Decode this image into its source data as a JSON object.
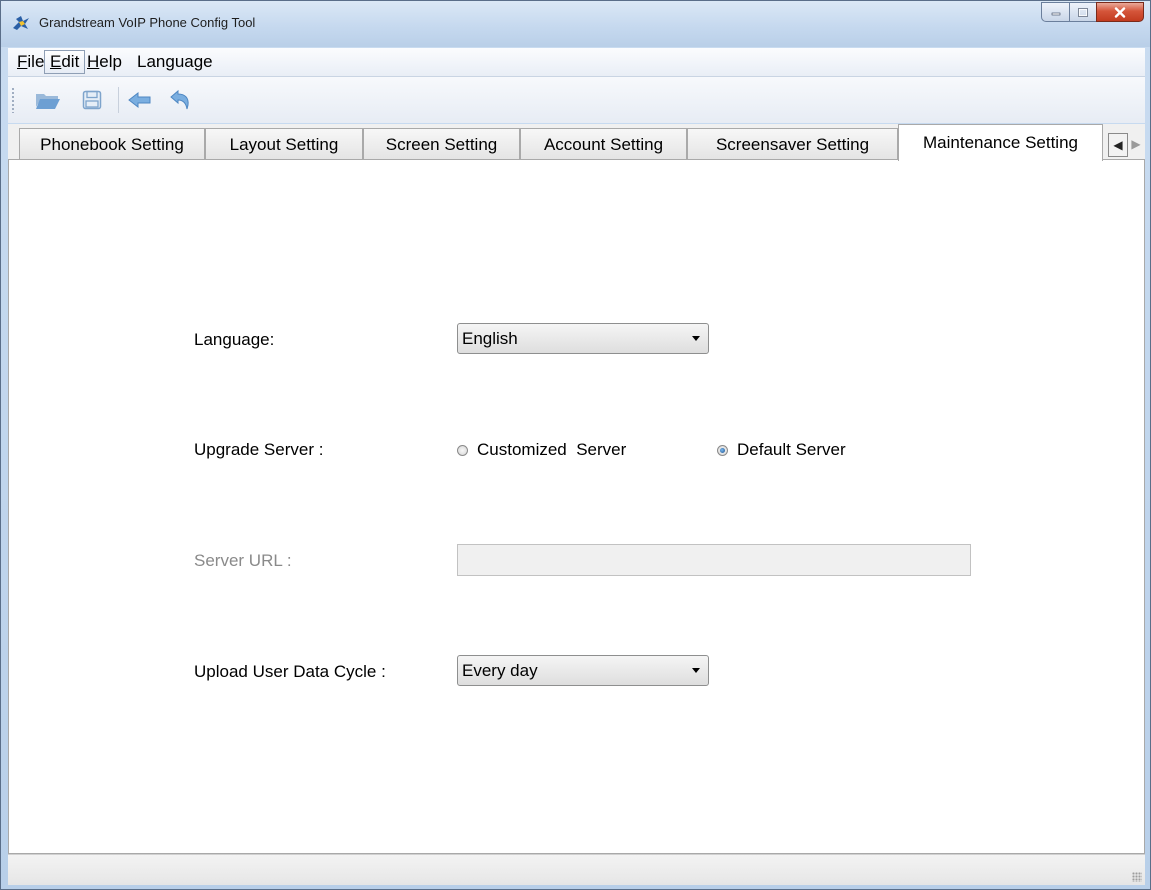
{
  "window": {
    "title": "Grandstream VoIP Phone Config Tool",
    "app_icon": "grandstream-logo-icon",
    "controls": {
      "minimize": "minimize-icon",
      "maximize": "maximize-icon",
      "close": "close-icon"
    }
  },
  "menu": {
    "items": [
      {
        "label": "File",
        "underline": "F",
        "rest": "ile",
        "active": false
      },
      {
        "label": "Edit",
        "underline": "E",
        "rest": "dit",
        "active": true
      },
      {
        "label": "Help",
        "underline": "H",
        "rest": "elp",
        "active": false
      },
      {
        "label": "Language",
        "underline": "",
        "rest": "Language",
        "active": false
      }
    ]
  },
  "toolbar": {
    "buttons": [
      {
        "icon": "open-folder-icon",
        "enabled": true
      },
      {
        "icon": "save-icon",
        "enabled": true
      },
      {
        "icon": "back-arrow-icon",
        "enabled": true
      },
      {
        "icon": "undo-icon",
        "enabled": true
      }
    ]
  },
  "tabs": {
    "items": [
      {
        "label": "Phonebook Setting",
        "selected": false
      },
      {
        "label": "Layout Setting",
        "selected": false
      },
      {
        "label": "Screen Setting",
        "selected": false
      },
      {
        "label": "Account Setting",
        "selected": false
      },
      {
        "label": "Screensaver Setting",
        "selected": false
      },
      {
        "label": "Maintenance Setting",
        "selected": true
      }
    ],
    "scroll_left_icon": "scroll-left-icon",
    "scroll_right_icon": "scroll-right-icon"
  },
  "maintenance": {
    "language_label": "Language:",
    "language_value": "English",
    "upgrade_server_label": "Upgrade Server :",
    "upgrade_options": [
      {
        "label": "Customized  Server",
        "checked": false
      },
      {
        "label": "Default Server",
        "checked": true
      }
    ],
    "server_url_label": "Server URL :",
    "server_url_value": "",
    "upload_cycle_label": "Upload User Data Cycle :",
    "upload_cycle_value": "Every day"
  },
  "colors": {
    "titlebar": "#c6d9ef",
    "close_button": "#c23b1f",
    "selected_radio": "#1a4d8c",
    "disabled_text": "#8a8a8a"
  }
}
